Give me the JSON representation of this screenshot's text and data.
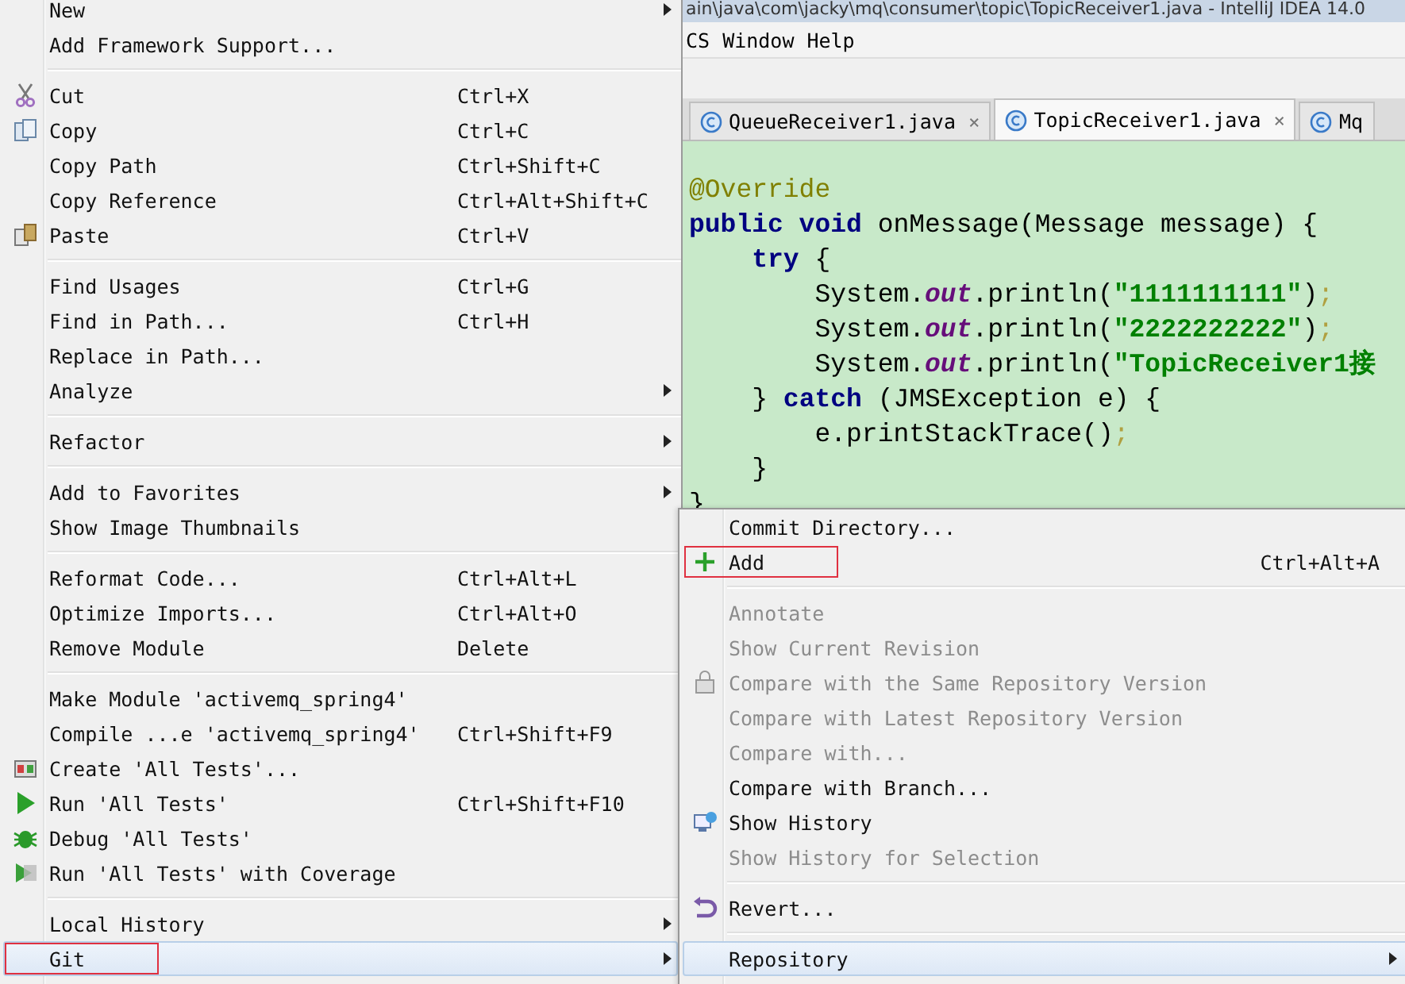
{
  "window": {
    "title": "ain\\java\\com\\jacky\\mq\\consumer\\topic\\TopicReceiver1.java - IntelliJ IDEA 14.0"
  },
  "menu_bar": [
    "CS",
    "Window",
    "Help"
  ],
  "editor_tabs": [
    {
      "label": "QueueReceiver1.java",
      "close": "×",
      "selected": false
    },
    {
      "label": "TopicReceiver1.java",
      "close": "×",
      "selected": true
    },
    {
      "label": "Mq",
      "selected": false
    }
  ],
  "code": [
    [
      {
        "kind": "annotation",
        "text": "@Override"
      }
    ],
    [
      {
        "kind": "keyword",
        "text": "public void "
      },
      {
        "kind": "plain",
        "text": "onMessage(Message message) {"
      }
    ],
    [
      {
        "kind": "keyword",
        "text": "    try "
      },
      {
        "kind": "plain",
        "text": "{"
      }
    ],
    [
      {
        "kind": "plain",
        "text": "        System."
      },
      {
        "kind": "field",
        "text": "out"
      },
      {
        "kind": "plain",
        "text": ".println("
      },
      {
        "kind": "string",
        "text": "\"1111111111\""
      },
      {
        "kind": "plain",
        "text": ")"
      },
      {
        "kind": "semi",
        "text": ";"
      }
    ],
    [
      {
        "kind": "plain",
        "text": "        System."
      },
      {
        "kind": "field",
        "text": "out"
      },
      {
        "kind": "plain",
        "text": ".println("
      },
      {
        "kind": "string",
        "text": "\"2222222222\""
      },
      {
        "kind": "plain",
        "text": ")"
      },
      {
        "kind": "semi",
        "text": ";"
      }
    ],
    [
      {
        "kind": "plain",
        "text": "        System."
      },
      {
        "kind": "field",
        "text": "out"
      },
      {
        "kind": "plain",
        "text": ".println("
      },
      {
        "kind": "string",
        "text": "\"TopicReceiver1接"
      }
    ],
    [
      {
        "kind": "plain",
        "text": "    } "
      },
      {
        "kind": "keyword",
        "text": "catch "
      },
      {
        "kind": "plain",
        "text": "(JMSException e) {"
      }
    ],
    [
      {
        "kind": "plain",
        "text": "        e.printStackTrace()"
      },
      {
        "kind": "semi",
        "text": ";"
      }
    ],
    [
      {
        "kind": "plain",
        "text": "    }"
      }
    ],
    [
      {
        "kind": "plain",
        "text": "}"
      }
    ]
  ],
  "context_menu": {
    "groups": [
      [
        {
          "label": "New",
          "kind": "plain",
          "submenu": true,
          "selected": false,
          "annotated": false
        },
        {
          "label": "Add Framework Support...",
          "kind": "plain",
          "selected": false,
          "annotated": false
        }
      ],
      [
        {
          "label": "Cut",
          "shortcut": "Ctrl+X",
          "kind": "scissors",
          "selected": false,
          "annotated": false
        },
        {
          "label": "Copy",
          "shortcut": "Ctrl+C",
          "kind": "copy",
          "selected": false,
          "annotated": false
        },
        {
          "label": "Copy Path",
          "shortcut": "Ctrl+Shift+C",
          "kind": "plain",
          "selected": false,
          "annotated": false
        },
        {
          "label": "Copy Reference",
          "shortcut": "Ctrl+Alt+Shift+C",
          "kind": "plain",
          "selected": false,
          "annotated": false
        },
        {
          "label": "Paste",
          "shortcut": "Ctrl+V",
          "kind": "paste",
          "selected": false,
          "annotated": false
        }
      ],
      [
        {
          "label": "Find Usages",
          "shortcut": "Ctrl+G",
          "kind": "plain",
          "selected": false,
          "annotated": false
        },
        {
          "label": "Find in Path...",
          "shortcut": "Ctrl+H",
          "kind": "plain",
          "selected": false,
          "annotated": false
        },
        {
          "label": "Replace in Path...",
          "kind": "plain",
          "selected": false,
          "annotated": false
        },
        {
          "label": "Analyze",
          "kind": "plain",
          "submenu": true,
          "selected": false,
          "annotated": false
        }
      ],
      [
        {
          "label": "Refactor",
          "kind": "plain",
          "submenu": true,
          "selected": false,
          "annotated": false
        }
      ],
      [
        {
          "label": "Add to Favorites",
          "kind": "plain",
          "submenu": true,
          "selected": false,
          "annotated": false
        },
        {
          "label": "Show Image Thumbnails",
          "kind": "plain",
          "selected": false,
          "annotated": false
        }
      ],
      [
        {
          "label": "Reformat Code...",
          "shortcut": "Ctrl+Alt+L",
          "kind": "plain",
          "selected": false,
          "annotated": false
        },
        {
          "label": "Optimize Imports...",
          "shortcut": "Ctrl+Alt+O",
          "kind": "plain",
          "selected": false,
          "annotated": false
        },
        {
          "label": "Remove Module",
          "shortcut": "Delete",
          "kind": "plain",
          "selected": false,
          "annotated": false
        }
      ],
      [
        {
          "label": "Make Module 'activemq_spring4'",
          "kind": "plain",
          "selected": false,
          "annotated": false
        },
        {
          "label": "Compile ...e 'activemq_spring4'",
          "shortcut": "Ctrl+Shift+F9",
          "kind": "plain",
          "selected": false,
          "annotated": false
        },
        {
          "label": "Create 'All Tests'...",
          "kind": "test",
          "selected": false,
          "annotated": false
        },
        {
          "label": "Run 'All Tests'",
          "shortcut": "Ctrl+Shift+F10",
          "kind": "run",
          "selected": false,
          "annotated": false
        },
        {
          "label": "Debug 'All Tests'",
          "kind": "bug",
          "selected": false,
          "annotated": false
        },
        {
          "label": "Run 'All Tests' with Coverage",
          "kind": "coverage",
          "selected": false,
          "annotated": false
        }
      ],
      [
        {
          "label": "Local History",
          "kind": "plain",
          "submenu": true,
          "selected": false,
          "annotated": false
        },
        {
          "label": "Git",
          "kind": "plain",
          "submenu": true,
          "selected": true,
          "annotated": true
        }
      ]
    ]
  },
  "git_submenu": {
    "groups": [
      [
        {
          "label": "Commit Directory...",
          "kind": "plain",
          "disabled": false,
          "selected": false,
          "annotated": false
        },
        {
          "label": "Add",
          "shortcut": "Ctrl+Alt+A",
          "kind": "plus",
          "disabled": false,
          "selected": false,
          "annotated": true
        }
      ],
      [
        {
          "label": "Annotate",
          "kind": "plain",
          "disabled": true,
          "selected": false,
          "annotated": false
        },
        {
          "label": "Show Current Revision",
          "kind": "plain",
          "disabled": true,
          "selected": false,
          "annotated": false
        },
        {
          "label": "Compare with the Same Repository Version",
          "kind": "compare",
          "disabled": true,
          "selected": false,
          "annotated": false
        },
        {
          "label": "Compare with Latest Repository Version",
          "kind": "plain",
          "disabled": true,
          "selected": false,
          "annotated": false
        },
        {
          "label": "Compare with...",
          "kind": "plain",
          "disabled": true,
          "selected": false,
          "annotated": false
        },
        {
          "label": "Compare with Branch...",
          "kind": "plain",
          "disabled": false,
          "selected": false,
          "annotated": false
        },
        {
          "label": "Show History",
          "kind": "history",
          "disabled": false,
          "selected": false,
          "annotated": false
        },
        {
          "label": "Show History for Selection",
          "kind": "plain",
          "disabled": true,
          "selected": false,
          "annotated": false
        }
      ],
      [
        {
          "label": "Revert...",
          "kind": "revert",
          "disabled": false,
          "selected": false,
          "annotated": false
        }
      ],
      [
        {
          "label": "Repository",
          "kind": "plain",
          "submenu": true,
          "disabled": false,
          "selected": true,
          "annotated": false
        }
      ]
    ]
  }
}
